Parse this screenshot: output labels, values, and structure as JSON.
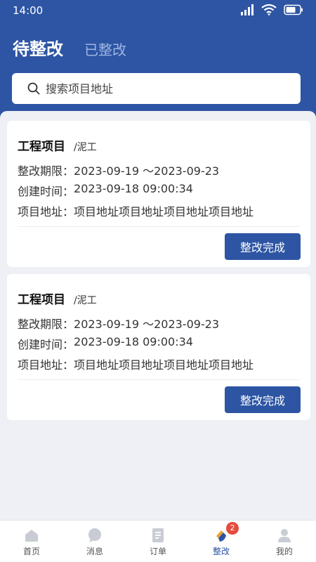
{
  "status_bar": {
    "time": "14:00"
  },
  "header": {
    "tabs": [
      {
        "label": "待整改",
        "active": true
      },
      {
        "label": "已整改",
        "active": false
      }
    ]
  },
  "search": {
    "placeholder": "搜索项目地址",
    "value": ""
  },
  "cards": [
    {
      "title": "工程项目",
      "subtitle": "/泥工",
      "deadline_label": "整改期限：",
      "deadline_value": "2023-09-19 ～2023-09-23",
      "created_label": "创建时间：",
      "created_value": "2023-09-18  09:00:34",
      "address_label": "项目地址：",
      "address_value": "项目地址项目地址项目地址项目地址",
      "button_label": "整改完成"
    },
    {
      "title": "工程项目",
      "subtitle": "/泥工",
      "deadline_label": "整改期限：",
      "deadline_value": "2023-09-19 ～2023-09-23",
      "created_label": "创建时间：",
      "created_value": "2023-09-18  09:00:34",
      "address_label": "项目地址：",
      "address_value": "项目地址项目地址项目地址项目地址",
      "button_label": "整改完成"
    }
  ],
  "tabbar": {
    "items": [
      {
        "label": "首页",
        "icon": "home-icon"
      },
      {
        "label": "消息",
        "icon": "message-icon"
      },
      {
        "label": "订单",
        "icon": "order-icon"
      },
      {
        "label": "整改",
        "icon": "rectify-icon",
        "active": true,
        "badge": "2"
      },
      {
        "label": "我的",
        "icon": "user-icon"
      }
    ]
  },
  "colors": {
    "primary": "#2d55a4",
    "background": "#eef0f5",
    "badge": "#e54b3c",
    "tab_inactive": "#9eb6e2"
  }
}
